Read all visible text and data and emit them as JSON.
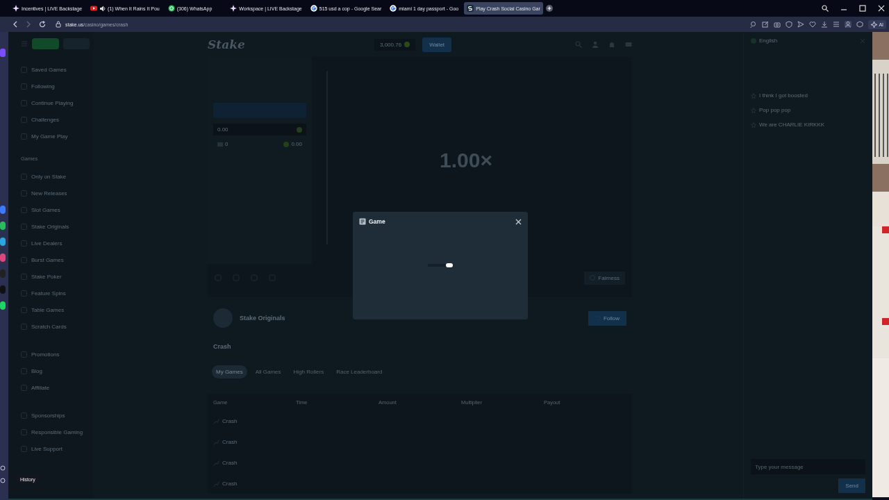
{
  "browser": {
    "tabs": [
      {
        "title": "Incentives | LIVE Backstage",
        "kind": "star",
        "audio": false,
        "selected": false
      },
      {
        "title": "(1) When It Rains It Pou",
        "kind": "video",
        "audio": true,
        "selected": false
      },
      {
        "title": "(306) WhatsApp",
        "kind": "chat",
        "audio": false,
        "selected": false
      },
      {
        "title": "Workspace | LIVE Backstage",
        "kind": "star",
        "audio": false,
        "selected": false
      },
      {
        "title": "515 usd a cop - Google Sear",
        "kind": "search",
        "audio": false,
        "selected": false
      },
      {
        "title": "miami 1 day passport - Goo",
        "kind": "search",
        "audio": false,
        "selected": false
      },
      {
        "title": "Play Crash Social Casino Gar",
        "kind": "letter",
        "audio": false,
        "selected": true
      }
    ],
    "url_host": "stake.us",
    "url_path": "/casino/games/crash",
    "ai_label": "AI"
  },
  "page": {
    "logo": "Stake",
    "balance": "3,000.76",
    "wallet_button": "Wallet",
    "sidebar": {
      "toggles": [
        {
          "selected": true
        },
        {
          "selected": false
        }
      ],
      "groups": [
        {
          "items": [
            "Saved Games",
            "Following",
            "Continue Playing",
            "Challenges",
            "My Game Play"
          ]
        },
        {
          "heading": "Games",
          "items": [
            "Only on Stake",
            "New Releases",
            "Slot Games",
            "Stake Originals",
            "Live Dealers",
            "Burst Games",
            "Stake Poker",
            "Feature Spins",
            "Table Games",
            "Scratch Cards"
          ]
        },
        {
          "items": [
            "Promotions",
            "Blog",
            "Affiliate"
          ]
        },
        {
          "items": [
            "Sponsorships",
            "Responsible Gaming",
            "Live Support"
          ]
        }
      ]
    },
    "bet_panel": {
      "amount": "0.00",
      "players": "0",
      "total": "0.00"
    },
    "game": {
      "multiplier": "1.00×",
      "fairness_button": "Fairness"
    },
    "provider": {
      "name": "Stake Originals",
      "follow_button": "Follow"
    },
    "bets": {
      "title": "Crash",
      "tabs": [
        {
          "label": "My Games",
          "selected": true
        },
        {
          "label": "All Games",
          "selected": false
        },
        {
          "label": "High Rollers",
          "selected": false
        },
        {
          "label": "Race Leaderboard",
          "selected": false
        }
      ],
      "columns": [
        "Game",
        "Time",
        "Amount",
        "Multiplier",
        "Payout"
      ],
      "rows": [
        {
          "game": "Crash"
        },
        {
          "game": "Crash"
        },
        {
          "game": "Crash"
        },
        {
          "game": "Crash"
        }
      ]
    },
    "chat": {
      "language": "English",
      "messages": [
        "I think I got boosted",
        "Pop pop pop",
        "We are CHARLIE KIRKKK"
      ],
      "placeholder": "Type your message",
      "send_button": "Send"
    }
  },
  "modal": {
    "title": "Game"
  },
  "tooltip": "History"
}
